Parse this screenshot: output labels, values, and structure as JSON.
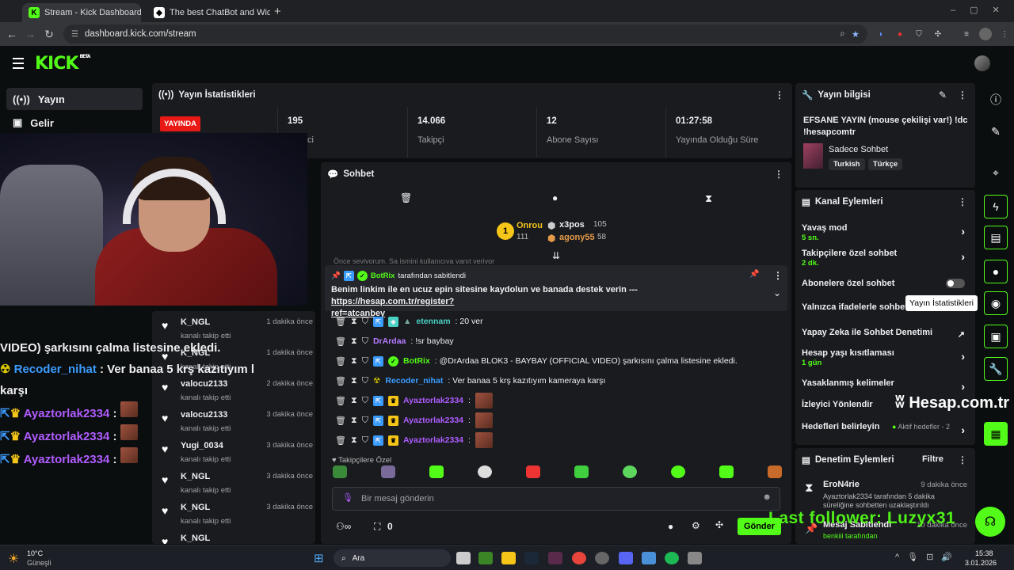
{
  "browser": {
    "tabs": [
      {
        "title": "Stream - Kick Dashboard",
        "active": true
      },
      {
        "title": "The best ChatBot and Widg",
        "active": false
      }
    ],
    "url": "dashboard.kick.com/stream"
  },
  "kick": {
    "logo": "KICK",
    "logo_sup": "BETA",
    "nav": [
      {
        "icon": "broadcast-icon",
        "label": "Yayın"
      },
      {
        "icon": "revenue-icon",
        "label": "Gelir"
      }
    ]
  },
  "stats": {
    "title": "Yayın İstatistikleri",
    "live_badge": "YAYINDA",
    "cells": [
      {
        "value": "195",
        "label": "İzleyici"
      },
      {
        "value": "14.066",
        "label": "Takipçi"
      },
      {
        "value": "12",
        "label": "Abone Sayısı"
      },
      {
        "value": "01:27:58",
        "label": "Yayında Olduğu Süre"
      }
    ]
  },
  "overlay_chat": [
    {
      "user": "",
      "text": "VIDEO) şarkısını çalma listesine ekledi."
    },
    {
      "user": "Recoder_nihat",
      "text": " : Ver banaa 5 krş kazıtıyım l"
    },
    {
      "user": "",
      "text": "karşı"
    },
    {
      "user": "Ayaztorlak2334",
      "text": " :"
    },
    {
      "user": "Ayaztorlak2334",
      "text": " :"
    },
    {
      "user": "Ayaztorlak2334",
      "text": " :"
    }
  ],
  "activity": [
    {
      "user": "K_NGL",
      "sub": "kanalı takip etti",
      "time": "1 dakika önce"
    },
    {
      "user": "K_NGL",
      "sub": "kanalı takip etti",
      "time": "1 dakika önce"
    },
    {
      "user": "valocu2133",
      "sub": "kanalı takip etti",
      "time": "2 dakika önce"
    },
    {
      "user": "valocu2133",
      "sub": "kanalı takip etti",
      "time": "3 dakika önce"
    },
    {
      "user": "Yugi_0034",
      "sub": "kanalı takip etti",
      "time": "3 dakika önce"
    },
    {
      "user": "K_NGL",
      "sub": "kanalı takip etti",
      "time": "3 dakika önce"
    },
    {
      "user": "K_NGL",
      "sub": "kanalı takip etti",
      "time": "3 dakika önce"
    },
    {
      "user": "K_NGL",
      "sub": "",
      "time": ""
    }
  ],
  "chat": {
    "title": "Sohbet",
    "leaderboard": {
      "first": {
        "name": "Onrou",
        "score": "111",
        "rank": "1"
      },
      "second": {
        "name": "x3pos",
        "score": "105"
      },
      "third": {
        "name": "agony55",
        "score": "58"
      }
    },
    "cut_line": "Önce seviyorum. Sa ismini kullanıcıya yanıt veriyor",
    "pinned": {
      "by": "BotRix",
      "by_suffix": " tarafından sabitlendi",
      "text": "Benim linkim ile en ucuz epin sitesine kaydolun ve banada destek verin --- ",
      "link1": "https://hesap.com.tr/register?",
      "link2": "ref=atcanbey"
    },
    "messages": [
      {
        "user": "etennam",
        "color": "#4ad0c4",
        "text": ": 20 ver"
      },
      {
        "user": "DrArdaa",
        "color": "#b57bff",
        "text": ": !sr baybay"
      },
      {
        "user": "BotRix",
        "color": "#53fc18",
        "text": ": @DrArdaa BLOK3 - BAYBAY (OFFICIAL VIDEO) şarkısını çalma listesine ekledi."
      },
      {
        "user": "Recoder_nihat",
        "color": "#3b9cff",
        "text": ": Ver banaa 5 krş kazıtıyım kameraya karşı"
      },
      {
        "user": "Ayaztorlak2334",
        "color": "#b05cff",
        "text": ":"
      },
      {
        "user": "Ayaztorlak2334",
        "color": "#b05cff",
        "text": ":"
      },
      {
        "user": "Ayaztorlak2334",
        "color": "#b05cff",
        "text": ":"
      }
    ],
    "emote_section": "Takipçilere Özel",
    "input_placeholder": "Bir mesaj gönderin",
    "points": "0",
    "send": "Gönder"
  },
  "stream_info": {
    "title": "Yayın bilgisi",
    "stream_title": "EFSANE YAYIN (mouse çekilişi var!) !dc !hesapcomtr",
    "category": "Sadece Sohbet",
    "tags": [
      "Turkish",
      "Türkçe"
    ]
  },
  "channel_actions": {
    "title": "Kanal Eylemleri",
    "items": [
      {
        "label": "Yavaş mod",
        "sub": "5 sn."
      },
      {
        "label": "Takipçilere özel sohbet",
        "sub": "2 dk."
      },
      {
        "label": "Abonelere özel sohbet",
        "sub": ""
      },
      {
        "label": "Yalnızca ifadelerle sohbet",
        "sub": ""
      },
      {
        "label": "Yapay Zeka ile Sohbet Denetimi",
        "sub": ""
      },
      {
        "label": "Hesap yaşı kısıtlaması",
        "sub": "1 gün"
      },
      {
        "label": "Yasaklanmış kelimeler",
        "sub": ""
      },
      {
        "label": "İzleyici Yönlendir",
        "sub": ""
      },
      {
        "label": "Hedefleri belirleyin",
        "sub": ""
      }
    ],
    "goals_status": "Aktif hedefler - 2"
  },
  "mod_actions": {
    "title": "Denetim Eylemleri",
    "filter": "Filtre",
    "items": [
      {
        "user": "EroN4rie",
        "time": "9 dakika önce",
        "detail": "Ayaztorlak2334 tarafından 5 dakika süreliğine sohbetten uzaklaştırıldı"
      },
      {
        "user": "Mesaj Sabitlendi",
        "time": "10 dakika önce",
        "detail": "benkiii tarafından"
      }
    ]
  },
  "tooltip": "Yayın İstatistikleri",
  "overlays": {
    "last_follower": "Last follower: Luzyx31",
    "watermark": "Hesap.com.tr"
  },
  "taskbar": {
    "weather_temp": "10°C",
    "weather_desc": "Güneşli",
    "search": "Ara",
    "time": "15:38",
    "date": "3.01.2026"
  }
}
